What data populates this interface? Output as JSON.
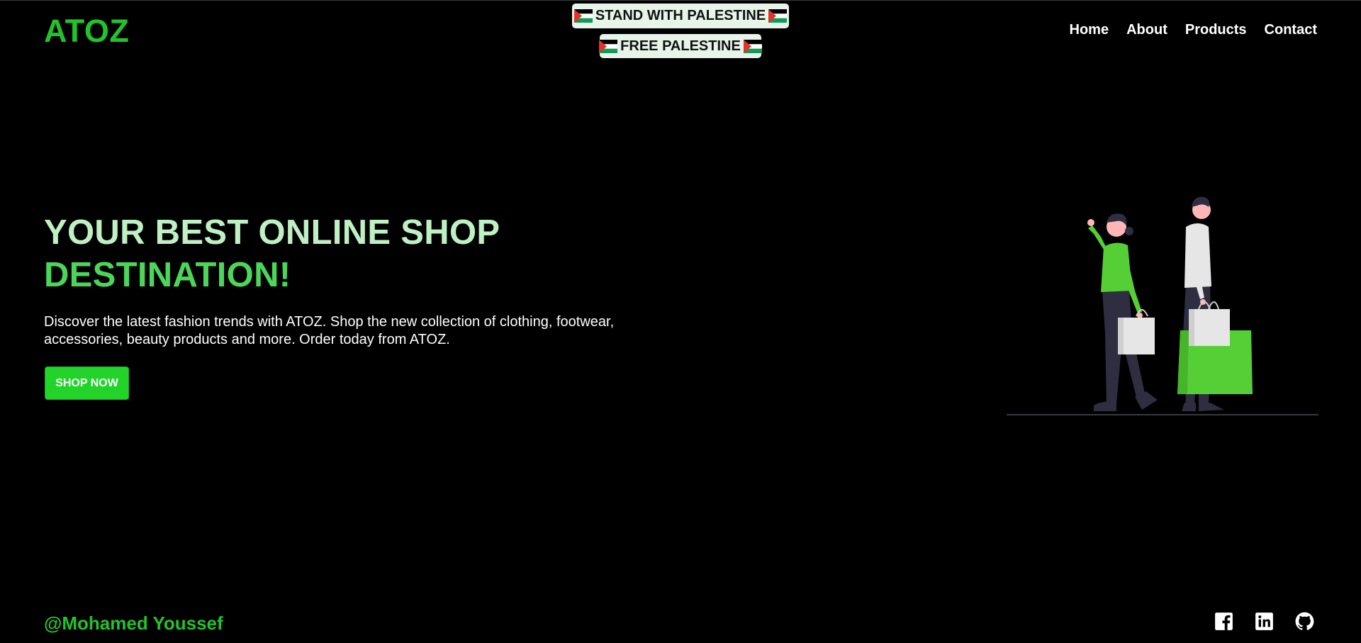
{
  "brand": {
    "logo": "ATOZ"
  },
  "nav": {
    "items": [
      {
        "label": "Home"
      },
      {
        "label": "About"
      },
      {
        "label": "Products"
      },
      {
        "label": "Contact"
      }
    ]
  },
  "banners": [
    {
      "text": "STAND WITH PALESTINE"
    },
    {
      "text": "FREE PALESTINE"
    }
  ],
  "hero": {
    "title_line1": "YOUR BEST ONLINE SHOP",
    "title_line2": "DESTINATION!",
    "description": "Discover the latest fashion trends with ATOZ. Shop the new collection of clothing, footwear, accessories, beauty products and more. Order today from ATOZ.",
    "cta_label": "SHOP NOW"
  },
  "footer": {
    "credit": "@Mohamed Youssef",
    "social_icons": [
      "facebook-icon",
      "linkedin-icon",
      "github-icon"
    ]
  },
  "colors": {
    "background": "#000000",
    "accent": "#22c32a",
    "title_light": "#bff0c4",
    "title_green": "#4bd65a",
    "button": "#22d42a",
    "banner_bg": "#e6f4ea"
  }
}
